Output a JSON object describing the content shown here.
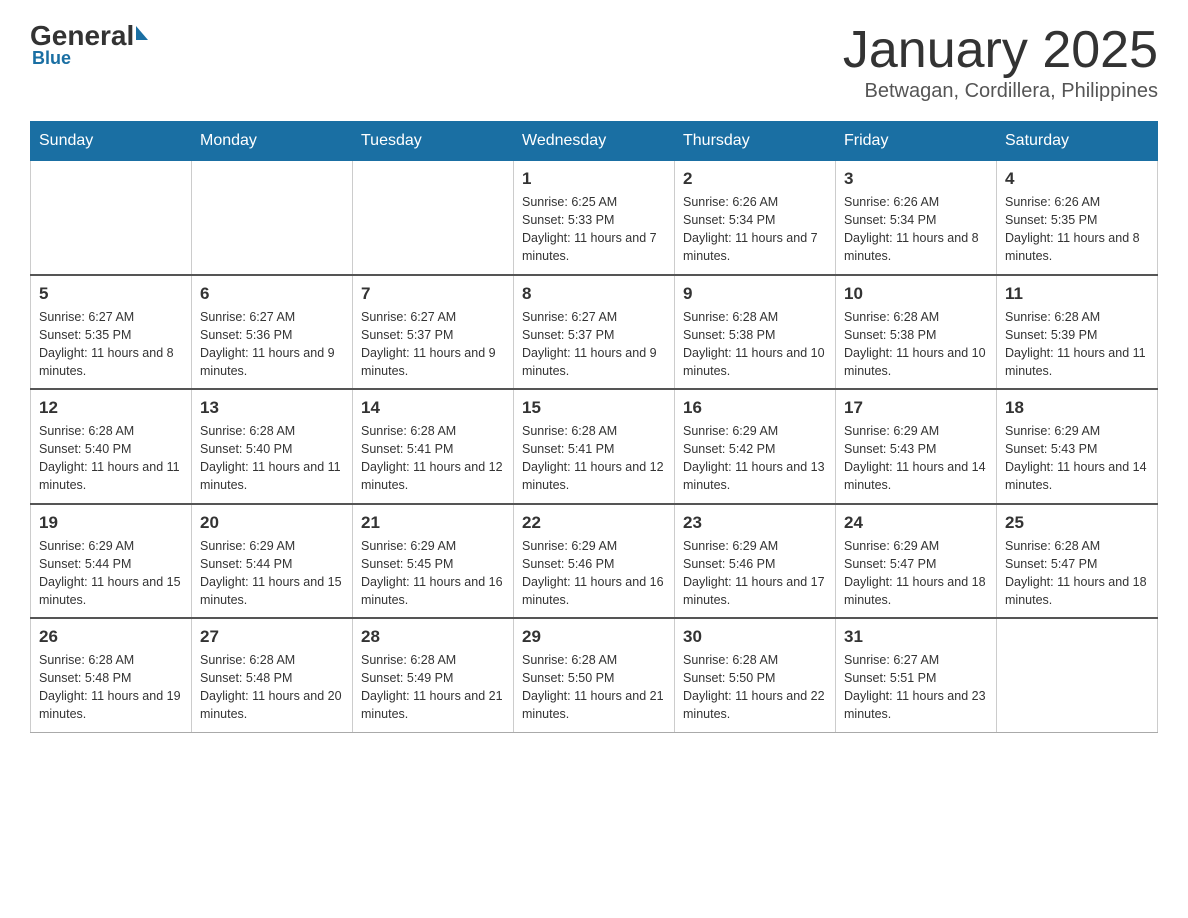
{
  "logo": {
    "general": "General",
    "blue": "Blue"
  },
  "title": "January 2025",
  "subtitle": "Betwagan, Cordillera, Philippines",
  "weekdays": [
    "Sunday",
    "Monday",
    "Tuesday",
    "Wednesday",
    "Thursday",
    "Friday",
    "Saturday"
  ],
  "weeks": [
    [
      null,
      null,
      null,
      {
        "day": "1",
        "sunrise": "6:25 AM",
        "sunset": "5:33 PM",
        "daylight": "11 hours and 7 minutes."
      },
      {
        "day": "2",
        "sunrise": "6:26 AM",
        "sunset": "5:34 PM",
        "daylight": "11 hours and 7 minutes."
      },
      {
        "day": "3",
        "sunrise": "6:26 AM",
        "sunset": "5:34 PM",
        "daylight": "11 hours and 8 minutes."
      },
      {
        "day": "4",
        "sunrise": "6:26 AM",
        "sunset": "5:35 PM",
        "daylight": "11 hours and 8 minutes."
      }
    ],
    [
      {
        "day": "5",
        "sunrise": "6:27 AM",
        "sunset": "5:35 PM",
        "daylight": "11 hours and 8 minutes."
      },
      {
        "day": "6",
        "sunrise": "6:27 AM",
        "sunset": "5:36 PM",
        "daylight": "11 hours and 9 minutes."
      },
      {
        "day": "7",
        "sunrise": "6:27 AM",
        "sunset": "5:37 PM",
        "daylight": "11 hours and 9 minutes."
      },
      {
        "day": "8",
        "sunrise": "6:27 AM",
        "sunset": "5:37 PM",
        "daylight": "11 hours and 9 minutes."
      },
      {
        "day": "9",
        "sunrise": "6:28 AM",
        "sunset": "5:38 PM",
        "daylight": "11 hours and 10 minutes."
      },
      {
        "day": "10",
        "sunrise": "6:28 AM",
        "sunset": "5:38 PM",
        "daylight": "11 hours and 10 minutes."
      },
      {
        "day": "11",
        "sunrise": "6:28 AM",
        "sunset": "5:39 PM",
        "daylight": "11 hours and 11 minutes."
      }
    ],
    [
      {
        "day": "12",
        "sunrise": "6:28 AM",
        "sunset": "5:40 PM",
        "daylight": "11 hours and 11 minutes."
      },
      {
        "day": "13",
        "sunrise": "6:28 AM",
        "sunset": "5:40 PM",
        "daylight": "11 hours and 11 minutes."
      },
      {
        "day": "14",
        "sunrise": "6:28 AM",
        "sunset": "5:41 PM",
        "daylight": "11 hours and 12 minutes."
      },
      {
        "day": "15",
        "sunrise": "6:28 AM",
        "sunset": "5:41 PM",
        "daylight": "11 hours and 12 minutes."
      },
      {
        "day": "16",
        "sunrise": "6:29 AM",
        "sunset": "5:42 PM",
        "daylight": "11 hours and 13 minutes."
      },
      {
        "day": "17",
        "sunrise": "6:29 AM",
        "sunset": "5:43 PM",
        "daylight": "11 hours and 14 minutes."
      },
      {
        "day": "18",
        "sunrise": "6:29 AM",
        "sunset": "5:43 PM",
        "daylight": "11 hours and 14 minutes."
      }
    ],
    [
      {
        "day": "19",
        "sunrise": "6:29 AM",
        "sunset": "5:44 PM",
        "daylight": "11 hours and 15 minutes."
      },
      {
        "day": "20",
        "sunrise": "6:29 AM",
        "sunset": "5:44 PM",
        "daylight": "11 hours and 15 minutes."
      },
      {
        "day": "21",
        "sunrise": "6:29 AM",
        "sunset": "5:45 PM",
        "daylight": "11 hours and 16 minutes."
      },
      {
        "day": "22",
        "sunrise": "6:29 AM",
        "sunset": "5:46 PM",
        "daylight": "11 hours and 16 minutes."
      },
      {
        "day": "23",
        "sunrise": "6:29 AM",
        "sunset": "5:46 PM",
        "daylight": "11 hours and 17 minutes."
      },
      {
        "day": "24",
        "sunrise": "6:29 AM",
        "sunset": "5:47 PM",
        "daylight": "11 hours and 18 minutes."
      },
      {
        "day": "25",
        "sunrise": "6:28 AM",
        "sunset": "5:47 PM",
        "daylight": "11 hours and 18 minutes."
      }
    ],
    [
      {
        "day": "26",
        "sunrise": "6:28 AM",
        "sunset": "5:48 PM",
        "daylight": "11 hours and 19 minutes."
      },
      {
        "day": "27",
        "sunrise": "6:28 AM",
        "sunset": "5:48 PM",
        "daylight": "11 hours and 20 minutes."
      },
      {
        "day": "28",
        "sunrise": "6:28 AM",
        "sunset": "5:49 PM",
        "daylight": "11 hours and 21 minutes."
      },
      {
        "day": "29",
        "sunrise": "6:28 AM",
        "sunset": "5:50 PM",
        "daylight": "11 hours and 21 minutes."
      },
      {
        "day": "30",
        "sunrise": "6:28 AM",
        "sunset": "5:50 PM",
        "daylight": "11 hours and 22 minutes."
      },
      {
        "day": "31",
        "sunrise": "6:27 AM",
        "sunset": "5:51 PM",
        "daylight": "11 hours and 23 minutes."
      },
      null
    ]
  ]
}
